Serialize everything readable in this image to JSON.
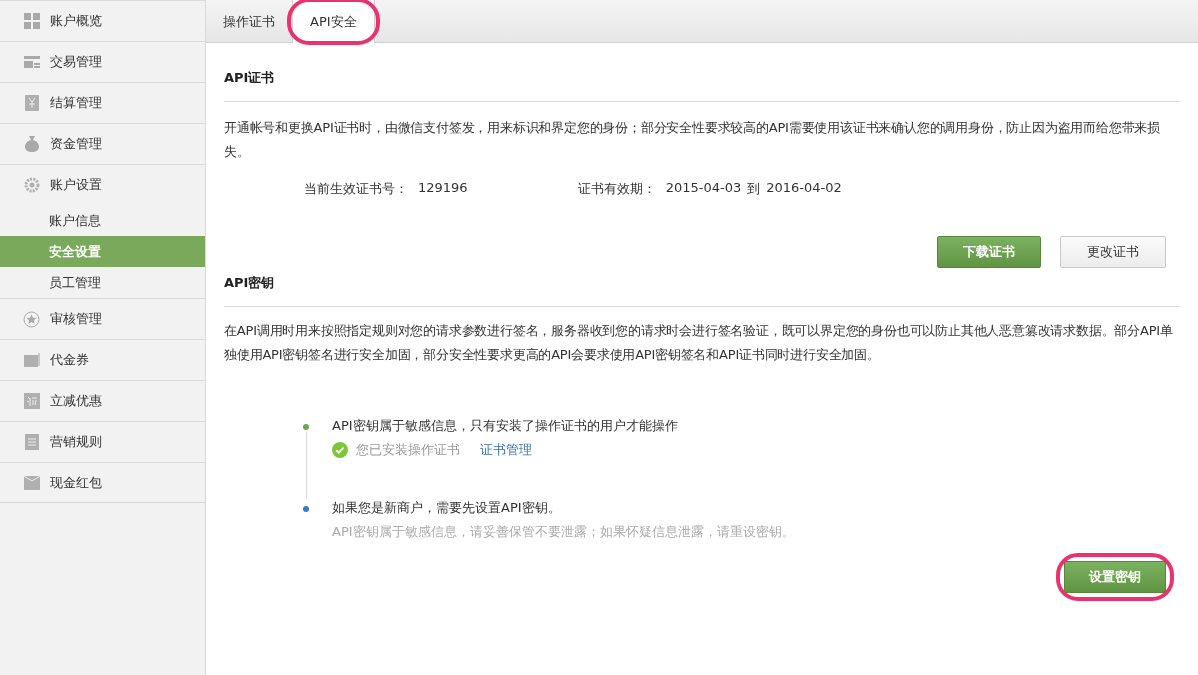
{
  "sidebar": {
    "items": [
      {
        "kind": "menu",
        "label": "账户概览",
        "selected": false
      },
      {
        "kind": "menu",
        "label": "交易管理",
        "selected": false
      },
      {
        "kind": "menu",
        "label": "结算管理",
        "selected": false
      },
      {
        "kind": "menu",
        "label": "资金管理",
        "selected": false
      },
      {
        "kind": "menu",
        "label": "账户设置",
        "selected": false
      },
      {
        "kind": "sub",
        "label": "账户信息",
        "selected": false
      },
      {
        "kind": "sub",
        "label": "安全设置",
        "selected": true
      },
      {
        "kind": "sub",
        "label": "员工管理",
        "selected": false
      },
      {
        "kind": "menu",
        "label": "审核管理",
        "selected": false
      },
      {
        "kind": "menu",
        "label": "代金券",
        "selected": false
      },
      {
        "kind": "menu",
        "label": "立减优惠",
        "selected": false
      },
      {
        "kind": "menu",
        "label": "营销规则",
        "selected": false
      },
      {
        "kind": "menu",
        "label": "现金红包",
        "selected": false
      }
    ]
  },
  "tabs": [
    {
      "label": "操作证书",
      "selected": false,
      "highlighted": false
    },
    {
      "label": "API安全",
      "selected": true,
      "highlighted": true
    }
  ],
  "certificate": {
    "title": "API证书",
    "description": "开通帐号和更换API证书时，由微信支付签发，用来标识和界定您的身份；部分安全性要求较高的API需要使用该证书来确认您的调用身份，防止因为盗用而给您带来损失。",
    "number_label": "当前生效证书号：",
    "number": "129196",
    "validity_label": "证书有效期：",
    "valid_from": "2015-04-03",
    "to": "到",
    "valid_to": "2016-04-02",
    "buttons": [
      {
        "label": "下载证书",
        "kind": "primary",
        "highlighted": false
      },
      {
        "label": "更改证书",
        "kind": "secondary",
        "highlighted": false
      }
    ]
  },
  "api_key": {
    "title": "API密钥",
    "description": "在API调用时用来按照指定规则对您的请求参数进行签名，服务器收到您的请求时会进行签名验证，既可以界定您的身份也可以防止其他人恶意篡改请求数据。部分API单独使用API密钥签名进行安全加固，部分安全性要求更高的API会要求使用API密钥签名和API证书同时进行安全加固。",
    "steps": [
      {
        "color": "#6aa84f",
        "title": "API密钥属于敏感信息，只有安装了操作证书的用户才能操作",
        "status": "您已安装操作证书",
        "link": "证书管理",
        "checked": true
      },
      {
        "color": "#2f7fc8",
        "title": "如果您是新商户，需要先设置API密钥。",
        "note": "API密钥属于敏感信息，请妥善保管不要泄露；如果怀疑信息泄露，请重设密钥。"
      }
    ],
    "buttons": [
      {
        "label": "设置密钥",
        "kind": "primary",
        "highlighted": true
      }
    ]
  }
}
